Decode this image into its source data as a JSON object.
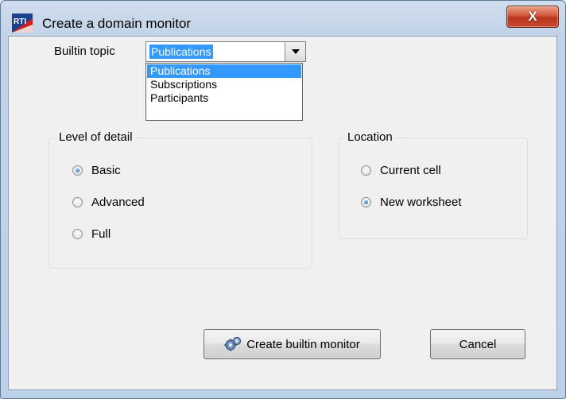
{
  "window": {
    "title": "Create a domain monitor",
    "close_glyph": "X"
  },
  "form": {
    "builtin_topic_label": "Builtin topic",
    "builtin_topic_value": "Publications",
    "dropdown_options": [
      "Publications",
      "Subscriptions",
      "Participants"
    ],
    "selected_option": "Publications"
  },
  "level_of_detail": {
    "title": "Level of detail",
    "options": [
      {
        "label": "Basic",
        "checked": true
      },
      {
        "label": "Advanced",
        "checked": false
      },
      {
        "label": "Full",
        "checked": false
      }
    ]
  },
  "location": {
    "title": "Location",
    "options": [
      {
        "label": "Current cell",
        "checked": false
      },
      {
        "label": "New worksheet",
        "checked": true
      }
    ]
  },
  "buttons": {
    "create_label": "Create builtin monitor",
    "create_icon": "gears-icon",
    "cancel_label": "Cancel"
  }
}
